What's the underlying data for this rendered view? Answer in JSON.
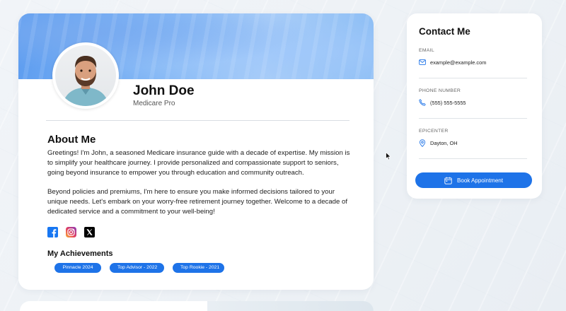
{
  "profile": {
    "name": "John Doe",
    "role": "Medicare Pro",
    "about_title": "About Me",
    "about_paragraphs": [
      "Greetings! I'm John, a seasoned Medicare insurance guide with a decade of expertise. My mission is to simplify your healthcare journey. I provide personalized and compassionate support to seniors, going beyond insurance to empower you through education and community outreach.",
      "Beyond policies and premiums, I'm here to ensure you make informed decisions tailored to your unique needs. Let's embark on your worry-free retirement journey together. Welcome to a decade of dedicated service and a commitment to your well-being!"
    ],
    "socials": [
      {
        "icon": "facebook-icon",
        "color": "#1877f2"
      },
      {
        "icon": "instagram-icon",
        "color": "#e4405f"
      },
      {
        "icon": "x-icon",
        "color": "#000000"
      }
    ],
    "achievements_title": "My Achievements",
    "achievements": [
      "Pinnacle 2024",
      "Top Advisor - 2022",
      "Top Rookie - 2021"
    ]
  },
  "contact": {
    "title": "Contact Me",
    "email_label": "EMAIL",
    "email_value": "example@example.com",
    "phone_label": "PHONE NUMBER",
    "phone_value": "(555) 555-5555",
    "epicenter_label": "EPICENTER",
    "epicenter_value": "Dayton, OH",
    "book_label": "Book Appointment"
  },
  "colors": {
    "accent": "#1e73e8",
    "banner": "#8bbcf6"
  }
}
